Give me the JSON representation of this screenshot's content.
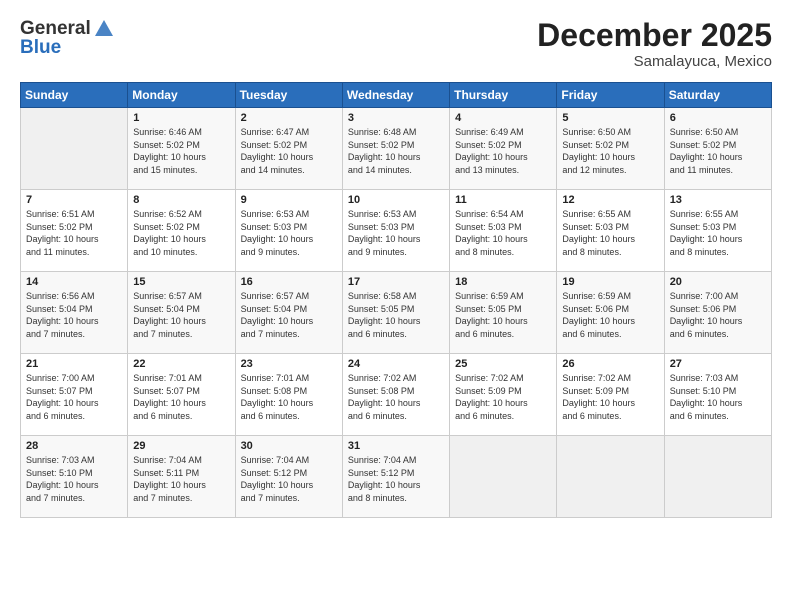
{
  "header": {
    "logo_line1": "General",
    "logo_line2": "Blue",
    "month": "December 2025",
    "location": "Samalayuca, Mexico"
  },
  "weekdays": [
    "Sunday",
    "Monday",
    "Tuesday",
    "Wednesday",
    "Thursday",
    "Friday",
    "Saturday"
  ],
  "weeks": [
    [
      {
        "day": "",
        "text": ""
      },
      {
        "day": "1",
        "text": "Sunrise: 6:46 AM\nSunset: 5:02 PM\nDaylight: 10 hours\nand 15 minutes."
      },
      {
        "day": "2",
        "text": "Sunrise: 6:47 AM\nSunset: 5:02 PM\nDaylight: 10 hours\nand 14 minutes."
      },
      {
        "day": "3",
        "text": "Sunrise: 6:48 AM\nSunset: 5:02 PM\nDaylight: 10 hours\nand 14 minutes."
      },
      {
        "day": "4",
        "text": "Sunrise: 6:49 AM\nSunset: 5:02 PM\nDaylight: 10 hours\nand 13 minutes."
      },
      {
        "day": "5",
        "text": "Sunrise: 6:50 AM\nSunset: 5:02 PM\nDaylight: 10 hours\nand 12 minutes."
      },
      {
        "day": "6",
        "text": "Sunrise: 6:50 AM\nSunset: 5:02 PM\nDaylight: 10 hours\nand 11 minutes."
      }
    ],
    [
      {
        "day": "7",
        "text": "Sunrise: 6:51 AM\nSunset: 5:02 PM\nDaylight: 10 hours\nand 11 minutes."
      },
      {
        "day": "8",
        "text": "Sunrise: 6:52 AM\nSunset: 5:02 PM\nDaylight: 10 hours\nand 10 minutes."
      },
      {
        "day": "9",
        "text": "Sunrise: 6:53 AM\nSunset: 5:03 PM\nDaylight: 10 hours\nand 9 minutes."
      },
      {
        "day": "10",
        "text": "Sunrise: 6:53 AM\nSunset: 5:03 PM\nDaylight: 10 hours\nand 9 minutes."
      },
      {
        "day": "11",
        "text": "Sunrise: 6:54 AM\nSunset: 5:03 PM\nDaylight: 10 hours\nand 8 minutes."
      },
      {
        "day": "12",
        "text": "Sunrise: 6:55 AM\nSunset: 5:03 PM\nDaylight: 10 hours\nand 8 minutes."
      },
      {
        "day": "13",
        "text": "Sunrise: 6:55 AM\nSunset: 5:03 PM\nDaylight: 10 hours\nand 8 minutes."
      }
    ],
    [
      {
        "day": "14",
        "text": "Sunrise: 6:56 AM\nSunset: 5:04 PM\nDaylight: 10 hours\nand 7 minutes."
      },
      {
        "day": "15",
        "text": "Sunrise: 6:57 AM\nSunset: 5:04 PM\nDaylight: 10 hours\nand 7 minutes."
      },
      {
        "day": "16",
        "text": "Sunrise: 6:57 AM\nSunset: 5:04 PM\nDaylight: 10 hours\nand 7 minutes."
      },
      {
        "day": "17",
        "text": "Sunrise: 6:58 AM\nSunset: 5:05 PM\nDaylight: 10 hours\nand 6 minutes."
      },
      {
        "day": "18",
        "text": "Sunrise: 6:59 AM\nSunset: 5:05 PM\nDaylight: 10 hours\nand 6 minutes."
      },
      {
        "day": "19",
        "text": "Sunrise: 6:59 AM\nSunset: 5:06 PM\nDaylight: 10 hours\nand 6 minutes."
      },
      {
        "day": "20",
        "text": "Sunrise: 7:00 AM\nSunset: 5:06 PM\nDaylight: 10 hours\nand 6 minutes."
      }
    ],
    [
      {
        "day": "21",
        "text": "Sunrise: 7:00 AM\nSunset: 5:07 PM\nDaylight: 10 hours\nand 6 minutes."
      },
      {
        "day": "22",
        "text": "Sunrise: 7:01 AM\nSunset: 5:07 PM\nDaylight: 10 hours\nand 6 minutes."
      },
      {
        "day": "23",
        "text": "Sunrise: 7:01 AM\nSunset: 5:08 PM\nDaylight: 10 hours\nand 6 minutes."
      },
      {
        "day": "24",
        "text": "Sunrise: 7:02 AM\nSunset: 5:08 PM\nDaylight: 10 hours\nand 6 minutes."
      },
      {
        "day": "25",
        "text": "Sunrise: 7:02 AM\nSunset: 5:09 PM\nDaylight: 10 hours\nand 6 minutes."
      },
      {
        "day": "26",
        "text": "Sunrise: 7:02 AM\nSunset: 5:09 PM\nDaylight: 10 hours\nand 6 minutes."
      },
      {
        "day": "27",
        "text": "Sunrise: 7:03 AM\nSunset: 5:10 PM\nDaylight: 10 hours\nand 6 minutes."
      }
    ],
    [
      {
        "day": "28",
        "text": "Sunrise: 7:03 AM\nSunset: 5:10 PM\nDaylight: 10 hours\nand 7 minutes."
      },
      {
        "day": "29",
        "text": "Sunrise: 7:04 AM\nSunset: 5:11 PM\nDaylight: 10 hours\nand 7 minutes."
      },
      {
        "day": "30",
        "text": "Sunrise: 7:04 AM\nSunset: 5:12 PM\nDaylight: 10 hours\nand 7 minutes."
      },
      {
        "day": "31",
        "text": "Sunrise: 7:04 AM\nSunset: 5:12 PM\nDaylight: 10 hours\nand 8 minutes."
      },
      {
        "day": "",
        "text": ""
      },
      {
        "day": "",
        "text": ""
      },
      {
        "day": "",
        "text": ""
      }
    ]
  ]
}
